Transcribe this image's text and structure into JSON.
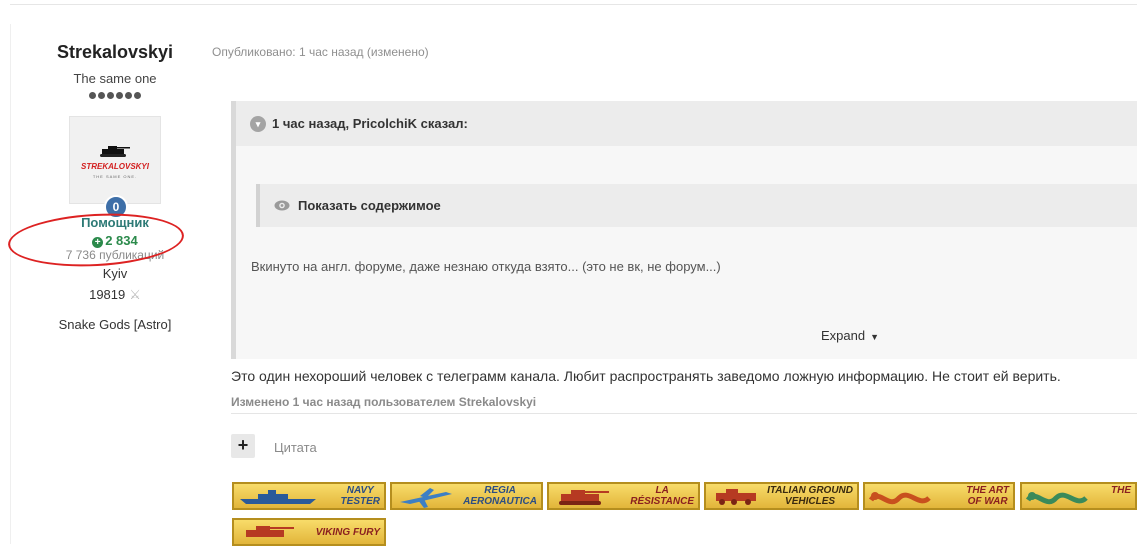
{
  "author": {
    "name": "Strekalovskyi",
    "title": "The same one",
    "avatar_text": "STREKALOVSKYI",
    "avatar_subtext": "THE SAME ONE.",
    "badge": "0",
    "group": "Помощник",
    "reputation": "2 834",
    "posts": "7 736 публикаций",
    "location": "Kyiv",
    "score": "19819",
    "clan": "Snake Gods [Astro]"
  },
  "post": {
    "meta": "Опубликовано: 1 час назад (изменено)",
    "quote_header": "1 час назад, PricolchiK сказал:",
    "spoiler_label": "Показать содержимое",
    "quote_text": "Вкинуто на англ. форуме, даже незнаю откуда взято... (это не вк, не форум...)",
    "expand_label": "Expand",
    "body": "Это один нехороший человек с телеграмм канала. Любит распространять заведомо ложную информацию. Не стоит ей верить.",
    "edited": "Изменено 1 час назад пользователем Strekalovskyi",
    "plus": "+",
    "quote_button": "Цитата"
  },
  "medals": [
    {
      "line1": "NAVY",
      "line2": "TESTER"
    },
    {
      "line1": "REGIA",
      "line2": "AERONAUTICA"
    },
    {
      "line1": "LA",
      "line2": "RÉSISTANCE"
    },
    {
      "line1": "ITALIAN GROUND",
      "line2": "VEHICLES"
    },
    {
      "line1": "THE ART",
      "line2": "OF WAR"
    },
    {
      "line1": "THE",
      "line2": ""
    },
    {
      "line1": "VIKING FURY",
      "line2": ""
    }
  ]
}
